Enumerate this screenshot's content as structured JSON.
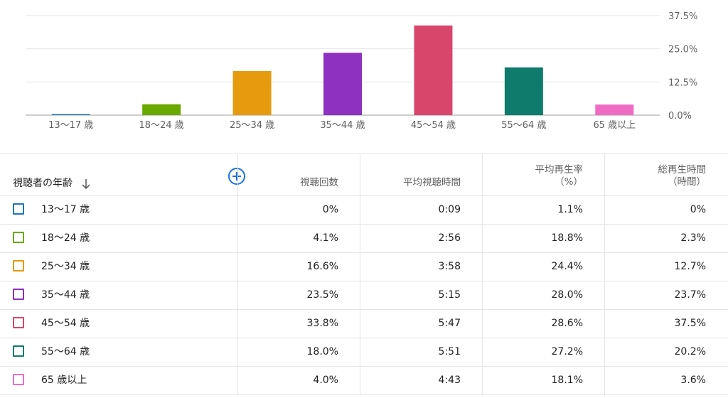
{
  "chart_data": {
    "type": "bar",
    "categories": [
      "13～17 歳",
      "18～24 歳",
      "25～34 歳",
      "35～44 歳",
      "45～54 歳",
      "55～64 歳",
      "65 歳以上"
    ],
    "values": [
      0,
      4.1,
      16.6,
      23.5,
      33.8,
      18.0,
      4.0
    ],
    "colors": [
      "#1f77b4",
      "#6aaa00",
      "#e69a0e",
      "#8e30c0",
      "#d9466c",
      "#0f7b6c",
      "#f06cc4"
    ],
    "yticks": [
      "37.5%",
      "25.0%",
      "12.5%",
      "0.0%"
    ],
    "ytick_values": [
      37.5,
      25.0,
      12.5,
      0.0
    ],
    "ylim": [
      0,
      37.5
    ],
    "grid": true
  },
  "table": {
    "header": {
      "dimension": "視聴者の年齢",
      "sort_icon": "arrow-down",
      "add_icon": "plus-circle",
      "columns": [
        {
          "line1": "視聴回数",
          "line2": ""
        },
        {
          "line1": "平均視聴時間",
          "line2": ""
        },
        {
          "line1": "平均再生率",
          "line2": "（%）"
        },
        {
          "line1": "総再生時間",
          "line2": "（時間）"
        }
      ]
    },
    "rows": [
      {
        "label": "13～17 歳",
        "color": "#1f77b4",
        "views": "0%",
        "avg_duration": "0:09",
        "avg_pct": "1.1%",
        "watch_time": "0%"
      },
      {
        "label": "18～24 歳",
        "color": "#6aaa00",
        "views": "4.1%",
        "avg_duration": "2:56",
        "avg_pct": "18.8%",
        "watch_time": "2.3%"
      },
      {
        "label": "25～34 歳",
        "color": "#e69a0e",
        "views": "16.6%",
        "avg_duration": "3:58",
        "avg_pct": "24.4%",
        "watch_time": "12.7%"
      },
      {
        "label": "35～44 歳",
        "color": "#8e30c0",
        "views": "23.5%",
        "avg_duration": "5:15",
        "avg_pct": "28.0%",
        "watch_time": "23.7%"
      },
      {
        "label": "45～54 歳",
        "color": "#d9466c",
        "views": "33.8%",
        "avg_duration": "5:47",
        "avg_pct": "28.6%",
        "watch_time": "37.5%"
      },
      {
        "label": "55～64 歳",
        "color": "#0f7b6c",
        "views": "18.0%",
        "avg_duration": "5:51",
        "avg_pct": "27.2%",
        "watch_time": "20.2%"
      },
      {
        "label": "65 歳以上",
        "color": "#f06cc4",
        "views": "4.0%",
        "avg_duration": "4:43",
        "avg_pct": "18.1%",
        "watch_time": "3.6%"
      }
    ]
  }
}
